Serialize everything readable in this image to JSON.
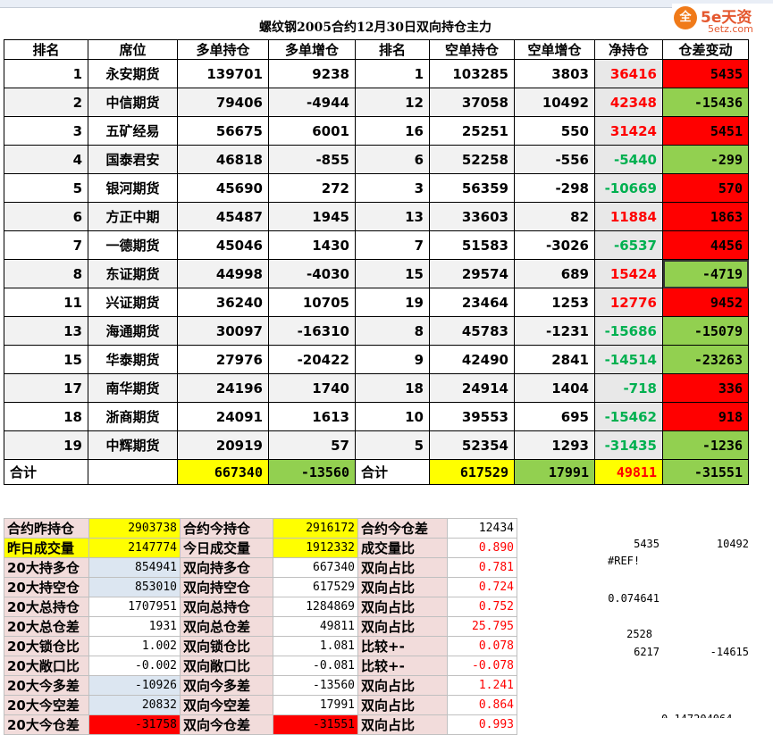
{
  "title": "螺纹钢2005合约12月30日双向持仓主力",
  "logo": {
    "circle": "全",
    "main": "5e天资",
    "sub": "5etz.com"
  },
  "headers": [
    "排名",
    "席位",
    "多单持仓",
    "多单增仓",
    "排名",
    "空单持仓",
    "空单增仓",
    "净持仓",
    "仓差变动"
  ],
  "rows": [
    {
      "rank": "1",
      "seat": "永安期货",
      "long": "139701",
      "long_chg": "9238",
      "short_rank": "1",
      "short": "103285",
      "short_chg": "3803",
      "net": "36416",
      "net_sign": "pos",
      "diff": "5435",
      "diff_color": "red"
    },
    {
      "rank": "2",
      "seat": "中信期货",
      "long": "79406",
      "long_chg": "-4944",
      "short_rank": "12",
      "short": "37058",
      "short_chg": "10492",
      "net": "42348",
      "net_sign": "pos",
      "diff": "-15436",
      "diff_color": "green"
    },
    {
      "rank": "3",
      "seat": "五矿经易",
      "long": "56675",
      "long_chg": "6001",
      "short_rank": "16",
      "short": "25251",
      "short_chg": "550",
      "net": "31424",
      "net_sign": "pos",
      "diff": "5451",
      "diff_color": "red"
    },
    {
      "rank": "4",
      "seat": "国泰君安",
      "long": "46818",
      "long_chg": "-855",
      "short_rank": "6",
      "short": "52258",
      "short_chg": "-556",
      "net": "-5440",
      "net_sign": "neg",
      "diff": "-299",
      "diff_color": "green"
    },
    {
      "rank": "5",
      "seat": "银河期货",
      "long": "45690",
      "long_chg": "272",
      "short_rank": "3",
      "short": "56359",
      "short_chg": "-298",
      "net": "-10669",
      "net_sign": "neg",
      "diff": "570",
      "diff_color": "red"
    },
    {
      "rank": "6",
      "seat": "方正中期",
      "long": "45487",
      "long_chg": "1945",
      "short_rank": "13",
      "short": "33603",
      "short_chg": "82",
      "net": "11884",
      "net_sign": "pos",
      "diff": "1863",
      "diff_color": "red"
    },
    {
      "rank": "7",
      "seat": "一德期货",
      "long": "45046",
      "long_chg": "1430",
      "short_rank": "7",
      "short": "51583",
      "short_chg": "-3026",
      "net": "-6537",
      "net_sign": "neg",
      "diff": "4456",
      "diff_color": "red"
    },
    {
      "rank": "8",
      "seat": "东证期货",
      "long": "44998",
      "long_chg": "-4030",
      "short_rank": "15",
      "short": "29574",
      "short_chg": "689",
      "net": "15424",
      "net_sign": "pos",
      "diff": "-4719",
      "diff_color": "green"
    },
    {
      "rank": "11",
      "seat": "兴证期货",
      "long": "36240",
      "long_chg": "10705",
      "short_rank": "19",
      "short": "23464",
      "short_chg": "1253",
      "net": "12776",
      "net_sign": "pos",
      "diff": "9452",
      "diff_color": "red"
    },
    {
      "rank": "13",
      "seat": "海通期货",
      "long": "30097",
      "long_chg": "-16310",
      "short_rank": "8",
      "short": "45783",
      "short_chg": "-1231",
      "net": "-15686",
      "net_sign": "neg",
      "diff": "-15079",
      "diff_color": "green"
    },
    {
      "rank": "15",
      "seat": "华泰期货",
      "long": "27976",
      "long_chg": "-20422",
      "short_rank": "9",
      "short": "42490",
      "short_chg": "2841",
      "net": "-14514",
      "net_sign": "neg",
      "diff": "-23263",
      "diff_color": "green"
    },
    {
      "rank": "17",
      "seat": "南华期货",
      "long": "24196",
      "long_chg": "1740",
      "short_rank": "18",
      "short": "24914",
      "short_chg": "1404",
      "net": "-718",
      "net_sign": "neg",
      "diff": "336",
      "diff_color": "red"
    },
    {
      "rank": "18",
      "seat": "浙商期货",
      "long": "24091",
      "long_chg": "1613",
      "short_rank": "10",
      "short": "39553",
      "short_chg": "695",
      "net": "-15462",
      "net_sign": "neg",
      "diff": "918",
      "diff_color": "red"
    },
    {
      "rank": "19",
      "seat": "中辉期货",
      "long": "20919",
      "long_chg": "57",
      "short_rank": "5",
      "short": "52354",
      "short_chg": "1293",
      "net": "-31435",
      "net_sign": "neg",
      "diff": "-1236",
      "diff_color": "green"
    }
  ],
  "total": {
    "label": "合计",
    "long": "667340",
    "long_chg": "-13560",
    "label2": "合计",
    "short": "617529",
    "short_chg": "17991",
    "net": "49811",
    "diff": "-31551"
  },
  "stats": [
    {
      "a": "合约昨持仓",
      "av": "2903738",
      "av_bg": "yellow",
      "b": "合约今持仓",
      "bv": "2916172",
      "bv_bg": "yellow",
      "c": "合约今仓差",
      "cv": "12434",
      "cv_red": false,
      "a_bg": "pink"
    },
    {
      "a": "昨日成交量",
      "av": "2147774",
      "av_bg": "yellow",
      "b": "今日成交量",
      "bv": "1912332",
      "bv_bg": "yellow",
      "c": "成交量比",
      "cv": "0.890",
      "cv_red": true,
      "a_bg": "yellow"
    },
    {
      "a": "20大持多仓",
      "av": "854941",
      "av_bg": "lblue",
      "b": "双向持多仓",
      "bv": "667340",
      "bv_bg": "none",
      "c": "双向占比",
      "cv": "0.781",
      "cv_red": true,
      "a_bg": "pink"
    },
    {
      "a": "20大持空仓",
      "av": "853010",
      "av_bg": "lblue",
      "b": "双向持空仓",
      "bv": "617529",
      "bv_bg": "none",
      "c": "双向占比",
      "cv": "0.724",
      "cv_red": true,
      "a_bg": "pink"
    },
    {
      "a": "20大总持仓",
      "av": "1707951",
      "av_bg": "none",
      "b": "双向总持仓",
      "bv": "1284869",
      "bv_bg": "none",
      "c": "双向占比",
      "cv": "0.752",
      "cv_red": true,
      "a_bg": "pink"
    },
    {
      "a": "20大总仓差",
      "av": "1931",
      "av_bg": "none",
      "b": "双向总仓差",
      "bv": "49811",
      "bv_bg": "none",
      "c": "双向占比",
      "cv": "25.795",
      "cv_red": true,
      "a_bg": "pink"
    },
    {
      "a": "20大锁仓比",
      "av": "1.002",
      "av_bg": "none",
      "b": "双向锁仓比",
      "bv": "1.081",
      "bv_bg": "none",
      "c": "比较+-",
      "cv": "0.078",
      "cv_red": true,
      "a_bg": "pink"
    },
    {
      "a": "20大敞口比",
      "av": "-0.002",
      "av_bg": "none",
      "b": "双向敞口比",
      "bv": "-0.081",
      "bv_bg": "none",
      "c": "比较+-",
      "cv": "-0.078",
      "cv_red": true,
      "a_bg": "pink"
    },
    {
      "a": "20大今多差",
      "av": "-10926",
      "av_bg": "lblue",
      "b": "双向今多差",
      "bv": "-13560",
      "bv_bg": "none",
      "c": "双向占比",
      "cv": "1.241",
      "cv_red": true,
      "a_bg": "pink"
    },
    {
      "a": "20大今空差",
      "av": "20832",
      "av_bg": "lblue",
      "b": "双向今空差",
      "bv": "17991",
      "bv_bg": "none",
      "c": "双向占比",
      "cv": "0.864",
      "cv_red": true,
      "a_bg": "pink"
    },
    {
      "a": "20大今仓差",
      "av": "-31758",
      "av_bg": "red",
      "b": "双向今仓差",
      "bv": "-31551",
      "bv_bg": "red",
      "c": "双向占比",
      "cv": "0.993",
      "cv_red": true,
      "a_bg": "pink"
    }
  ],
  "side_values": {
    "r1a": "5435",
    "r1b": "10492",
    "r2a": "#REF!",
    "r3a": "0.074641",
    "r4a": "2528",
    "r5a": "6217",
    "r5b": "-14615",
    "bottom": "0.147204064"
  }
}
